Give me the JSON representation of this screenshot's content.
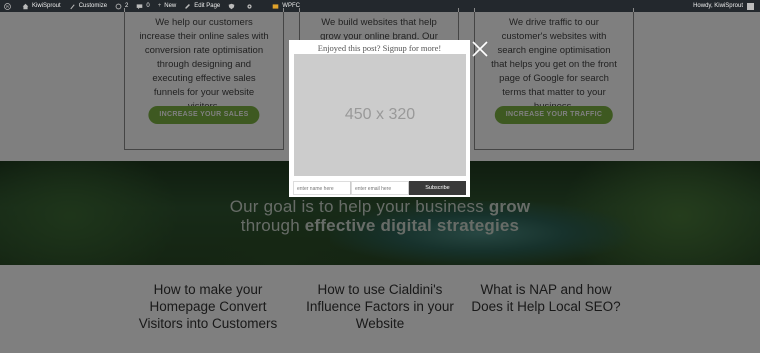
{
  "adminbar": {
    "site_name": "KiwiSprout",
    "customize": "Customize",
    "updates_count": "2",
    "comments_count": "0",
    "new_label": "New",
    "edit_page": "Edit Page",
    "wpfc": "WPFC",
    "greeting": "Howdy, KiwiSprout"
  },
  "services": [
    {
      "text": "We help our customers increase their online sales with conversion rate optimisation through designing and executing effective sales funnels for your website visitors.",
      "button": "INCREASE YOUR SALES"
    },
    {
      "text": "We build websites that help grow your online brand. Our websites",
      "button": ""
    },
    {
      "text": "We drive traffic to our customer's websites with search engine optimisation that helps you get on the front page of Google for search terms that matter to your business.",
      "button": "INCREASE YOUR TRAFFIC"
    }
  ],
  "hero": {
    "line1_plain": "Our goal is to help your business ",
    "line1_bold": "grow",
    "line2_plain": "through ",
    "line2_bold": "effective digital strategies"
  },
  "posts": [
    "How to make your Homepage Convert Visitors into Customers",
    "How to use Cialdini's Influence Factors in your Website",
    "What is NAP and how Does it Help Local SEO?"
  ],
  "popup": {
    "title": "Enjoyed this post? Signup for more!",
    "image_text": "450 x 320",
    "name_placeholder": "enter name here",
    "email_placeholder": "enter email here",
    "subscribe": "Subscribe"
  },
  "colors": {
    "admin_bar": "#23282d",
    "button_green": "#7cb342",
    "overlay": "rgba(0,0,0,0.5)",
    "subscribe_bg": "#3a3a3a"
  }
}
